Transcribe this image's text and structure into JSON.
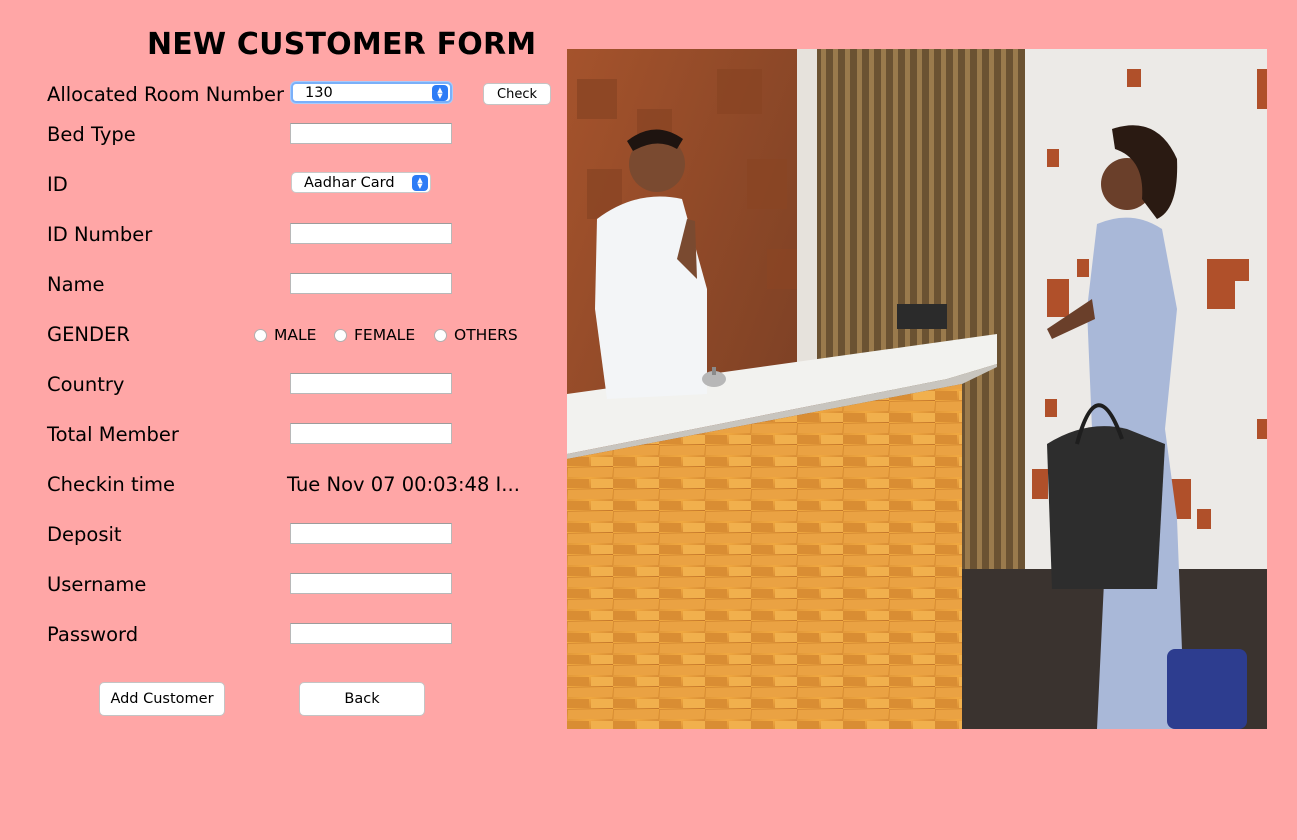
{
  "form": {
    "title": "NEW CUSTOMER FORM",
    "labels": {
      "room": "Allocated Room Number",
      "bed": "Bed Type",
      "id": "ID",
      "id_number": "ID Number",
      "name": "Name",
      "gender": "GENDER",
      "country": "Country",
      "total_member": "Total Member",
      "checkin": "Checkin time",
      "deposit": "Deposit",
      "username": "Username",
      "password": "Password"
    },
    "room_select": {
      "value": "130"
    },
    "id_select": {
      "value": "Aadhar Card"
    },
    "check_button": "Check",
    "gender_options": [
      "MALE",
      "FEMALE",
      "OTHERS"
    ],
    "checkin_value": "Tue Nov 07 00:03:48 I...",
    "fields": {
      "bed": "",
      "id_number": "",
      "name": "",
      "country": "",
      "total_member": "",
      "deposit": "",
      "username": "",
      "password": ""
    },
    "add_button": "Add Customer",
    "back_button": "Back"
  },
  "colors": {
    "background": "#ffa6a6",
    "select_accent": "#2d7cf6"
  },
  "photo": {
    "icon": "hotel-reception-photo"
  }
}
